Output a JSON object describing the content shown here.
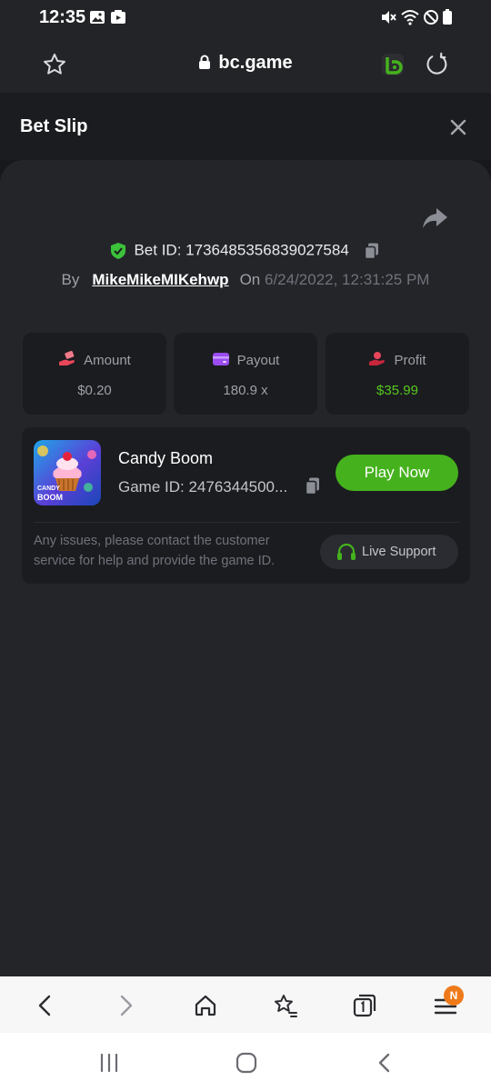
{
  "status_bar": {
    "time": "12:35"
  },
  "browser": {
    "url": "bc.game"
  },
  "slip": {
    "title": "Bet Slip",
    "bet_id_label": "Bet ID: 1736485356839027584",
    "by_label": "By",
    "username": "MikeMikeMIKehwp",
    "on_label": "On",
    "date": "6/24/2022, 12:31:25 PM"
  },
  "stats": [
    {
      "label": "Amount",
      "value": "$0.20",
      "icon": "money-hand-icon"
    },
    {
      "label": "Payout",
      "value": "180.9 x",
      "icon": "wallet-card-icon"
    },
    {
      "label": "Profit",
      "value": "$35.99",
      "icon": "profit-hand-icon"
    }
  ],
  "game": {
    "name": "Candy Boom",
    "game_id": "Game ID: 2476344500...",
    "thumb_text_1": "CANDY",
    "thumb_text_2": "BOOM",
    "play_label": "Play Now",
    "issues_text": "Any issues, please contact the customer service for help and provide the game ID.",
    "support_label": "Live Support"
  },
  "bottom_nav": {
    "badge": "N"
  },
  "colors": {
    "accent_green": "#45b21d",
    "profit_green": "#56c81e",
    "badge_orange": "#ef7a1a"
  }
}
